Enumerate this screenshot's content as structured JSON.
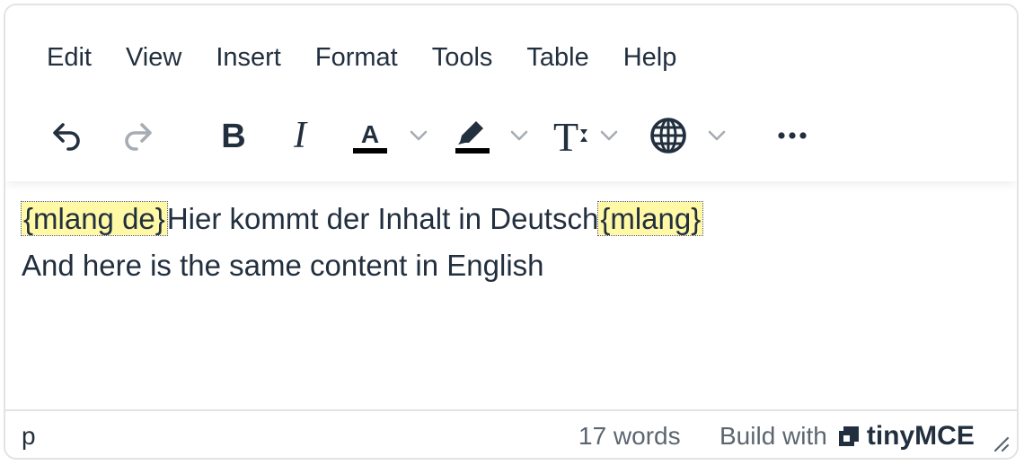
{
  "menubar": {
    "items": [
      "Edit",
      "View",
      "Insert",
      "Format",
      "Tools",
      "Table",
      "Help"
    ]
  },
  "toolbar": {
    "buttons": [
      "undo-icon",
      "redo-icon",
      "bold-icon",
      "italic-icon",
      "text-color-icon",
      "highlight-icon",
      "font-size-icon",
      "language-globe-icon",
      "more-icon"
    ]
  },
  "content": {
    "line1": {
      "open_tag": "{mlang de}",
      "text": "Hier kommt der Inhalt in Deutsch",
      "close_tag": "{mlang}"
    },
    "line2": "And here is the same content in English"
  },
  "statusbar": {
    "path": "p",
    "word_count": "17 words",
    "branding_prefix": "Build with",
    "branding_name": "tinyMCE"
  },
  "colors": {
    "text": "#222f3e",
    "disabled": "#a6acb3",
    "tag_highlight": "#fff9a6"
  }
}
